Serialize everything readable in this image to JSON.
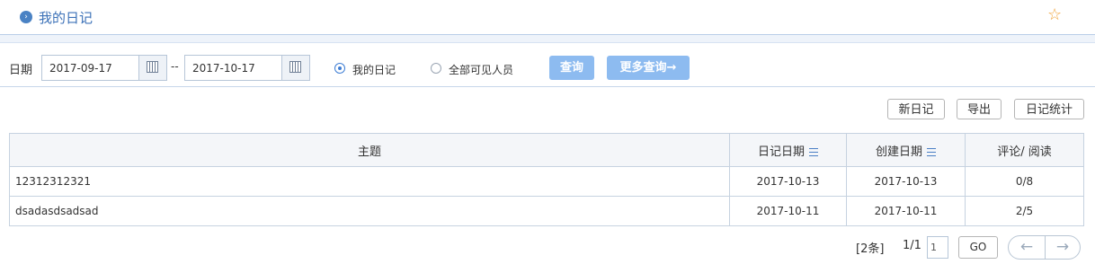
{
  "header": {
    "title": "我的日记",
    "star_icon": "star-icon"
  },
  "filter": {
    "date_label": "日期",
    "start_date": "2017-09-17",
    "separator": "--",
    "end_date": "2017-10-17",
    "radio_mine": "我的日记",
    "radio_all": "全部可见人员",
    "selected": "我的日记",
    "query_label": "查询",
    "more_query_label": "更多查询→"
  },
  "toolbar": {
    "new_label": "新日记",
    "export_label": "导出",
    "stats_label": "日记统计"
  },
  "table": {
    "columns": [
      "主题",
      "日记日期",
      "创建日期",
      "评论/ 阅读"
    ],
    "rows": [
      {
        "subject": "12312312321",
        "diary_date": "2017-10-13",
        "created_date": "2017-10-13",
        "comments_reads": "0/8"
      },
      {
        "subject": "dsadasdsadsad",
        "diary_date": "2017-10-11",
        "created_date": "2017-10-11",
        "comments_reads": "2/5"
      }
    ]
  },
  "pager": {
    "count": "[2条]",
    "pages": "1/1",
    "page_input": "1",
    "go_label": "GO",
    "prev": "←",
    "next": "→"
  },
  "colors": {
    "accent": "#3d72b8",
    "button": "#8dbbf0",
    "star": "#f0a33a"
  }
}
